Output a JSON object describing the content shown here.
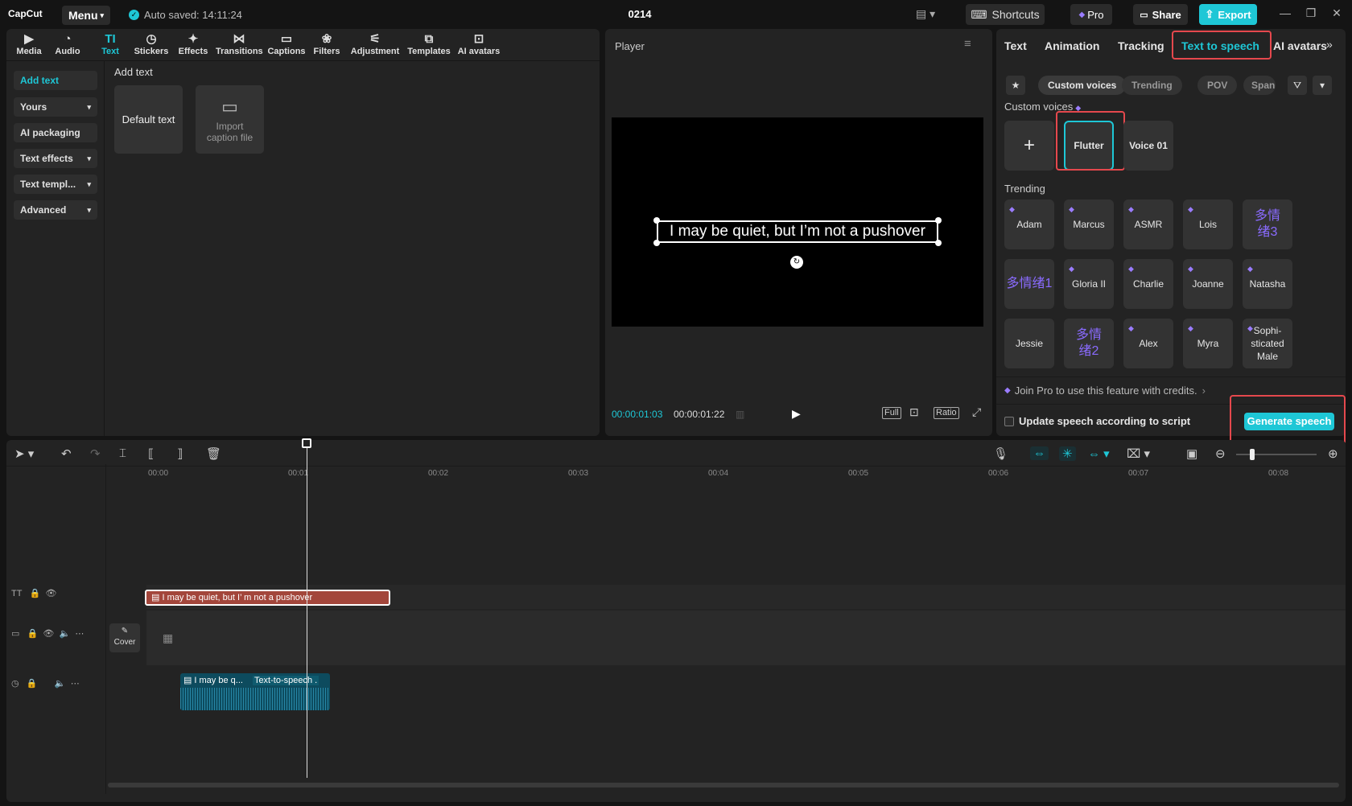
{
  "titlebar": {
    "logo": "CapCut",
    "menu_label": "Menu",
    "autosave": "Auto saved: 14:11:24",
    "project_title": "0214",
    "shortcuts_label": "Shortcuts",
    "pro_label": "Pro",
    "share_label": "Share",
    "export_label": "Export"
  },
  "toolbar": [
    {
      "label": "Media",
      "icon": "media-icon"
    },
    {
      "label": "Audio",
      "icon": "audio-icon"
    },
    {
      "label": "Text",
      "icon": "text-icon"
    },
    {
      "label": "Stickers",
      "icon": "stickers-icon"
    },
    {
      "label": "Effects",
      "icon": "effects-icon"
    },
    {
      "label": "Transitions",
      "icon": "transitions-icon"
    },
    {
      "label": "Captions",
      "icon": "captions-icon"
    },
    {
      "label": "Filters",
      "icon": "filters-icon"
    },
    {
      "label": "Adjustment",
      "icon": "adjustment-icon"
    },
    {
      "label": "Templates",
      "icon": "templates-icon"
    },
    {
      "label": "AI avatars",
      "icon": "ai-avatars-icon"
    }
  ],
  "text_categories": [
    "Add text",
    "Yours",
    "AI packaging",
    "Text effects",
    "Text templ...",
    "Advanced"
  ],
  "add_text": {
    "heading": "Add text",
    "default_text": "Default text",
    "import_caption": "Import caption file"
  },
  "player": {
    "label": "Player",
    "caption": "I may be quiet, but I’m not a pushover",
    "time_current": "00:00:01:03",
    "time_total": "00:00:01:22",
    "full_label": "Full",
    "ratio_label": "Ratio"
  },
  "right_panel": {
    "tabs": [
      "Text",
      "Animation",
      "Tracking",
      "Text to speech",
      "AI avatars"
    ],
    "filter_chips": [
      "Custom voices",
      "Trending",
      "POV",
      "Span"
    ],
    "custom_voices_label": "Custom voices",
    "custom_voices": [
      "Flutter",
      "Voice 01"
    ],
    "trending_label": "Trending",
    "trending_voices": [
      "Adam",
      "Marcus",
      "ASMR",
      "Lois",
      "多情绪3",
      "多情绪1",
      "Gloria II",
      "Charlie",
      "Joanne",
      "Natasha",
      "Jessie",
      "多情绪2",
      "Alex",
      "Myra",
      "Sophi-sticated Male"
    ],
    "pro_note": "Join Pro to use this feature with credits.",
    "update_label": "Update speech according to script",
    "generate_label": "Generate speech"
  },
  "timeline": {
    "ruler": [
      "00:00",
      "00:01",
      "00:02",
      "00:03",
      "00:04",
      "00:05",
      "00:06",
      "00:07",
      "00:08"
    ],
    "text_clip": "I may be quiet, but I’  m not a pushover",
    "cover_label": "Cover",
    "audio_clip_1": "I may be q...",
    "audio_clip_2": "Text-to-speech ."
  },
  "colors": {
    "accent": "#1ec7d6",
    "highlight": "#e5484d",
    "text_clip": "#a3463b",
    "audio_clip": "#0d4b5e",
    "pro_gem": "#9a7cff"
  }
}
